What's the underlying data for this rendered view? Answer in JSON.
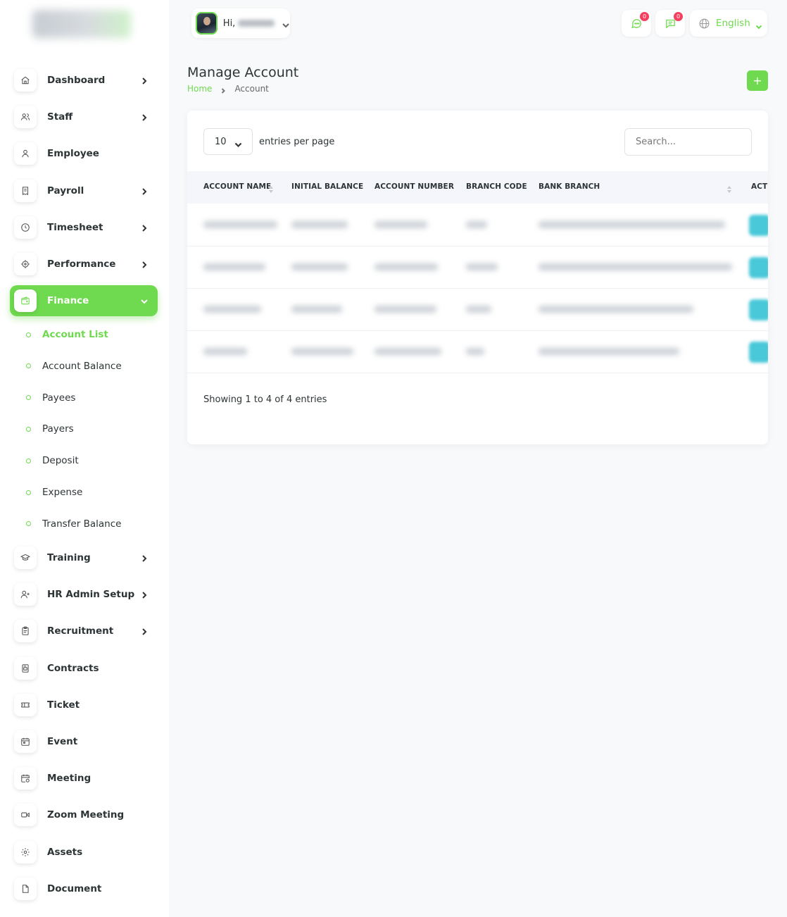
{
  "header": {
    "greeting": "Hi,",
    "notifications": [
      {
        "name": "chat",
        "count": "0"
      },
      {
        "name": "message",
        "count": "0"
      }
    ],
    "language": "English"
  },
  "sidebar": {
    "items": [
      {
        "label": "Dashboard",
        "icon": "home-icon",
        "chevron": true
      },
      {
        "label": "Staff",
        "icon": "users-icon",
        "chevron": true
      },
      {
        "label": "Employee",
        "icon": "user-icon",
        "chevron": false
      },
      {
        "label": "Payroll",
        "icon": "receipt-icon",
        "chevron": true
      },
      {
        "label": "Timesheet",
        "icon": "clock-icon",
        "chevron": true
      },
      {
        "label": "Performance",
        "icon": "target-icon",
        "chevron": true
      },
      {
        "label": "Finance",
        "icon": "wallet-icon",
        "chevron": true,
        "active": true
      }
    ],
    "finance_sub": [
      {
        "label": "Account List",
        "active": true
      },
      {
        "label": "Account Balance"
      },
      {
        "label": "Payees"
      },
      {
        "label": "Payers"
      },
      {
        "label": "Deposit"
      },
      {
        "label": "Expense"
      },
      {
        "label": "Transfer Balance"
      }
    ],
    "items_after": [
      {
        "label": "Training",
        "icon": "graduation-cap-icon",
        "chevron": true
      },
      {
        "label": "HR Admin Setup",
        "icon": "user-plus-icon",
        "chevron": true
      },
      {
        "label": "Recruitment",
        "icon": "clipboard-icon",
        "chevron": true
      },
      {
        "label": "Contracts",
        "icon": "file-contract-icon",
        "chevron": false
      },
      {
        "label": "Ticket",
        "icon": "ticket-icon",
        "chevron": false
      },
      {
        "label": "Event",
        "icon": "calendar-icon",
        "chevron": false
      },
      {
        "label": "Meeting",
        "icon": "calendar-clock-icon",
        "chevron": false
      },
      {
        "label": "Zoom Meeting",
        "icon": "video-icon",
        "chevron": false
      },
      {
        "label": "Assets",
        "icon": "gear-icon",
        "chevron": false
      },
      {
        "label": "Document",
        "icon": "document-icon",
        "chevron": false
      }
    ]
  },
  "page": {
    "title": "Manage Account",
    "breadcrumb": {
      "home": "Home",
      "current": "Account"
    },
    "add_label": "+"
  },
  "table": {
    "per_page_value": "10",
    "per_page_label": "entries per page",
    "search_placeholder": "Search...",
    "columns": [
      "ACCOUNT NAME",
      "INITIAL BALANCE",
      "ACCOUNT NUMBER",
      "BRANCH CODE",
      "BANK BRANCH",
      "ACTI"
    ],
    "row_count": 4,
    "showing": "Showing 1 to 4 of 4 entries"
  },
  "colors": {
    "accent": "#6fd94f",
    "badge": "#f43f5e",
    "action": "#48c8d8"
  }
}
